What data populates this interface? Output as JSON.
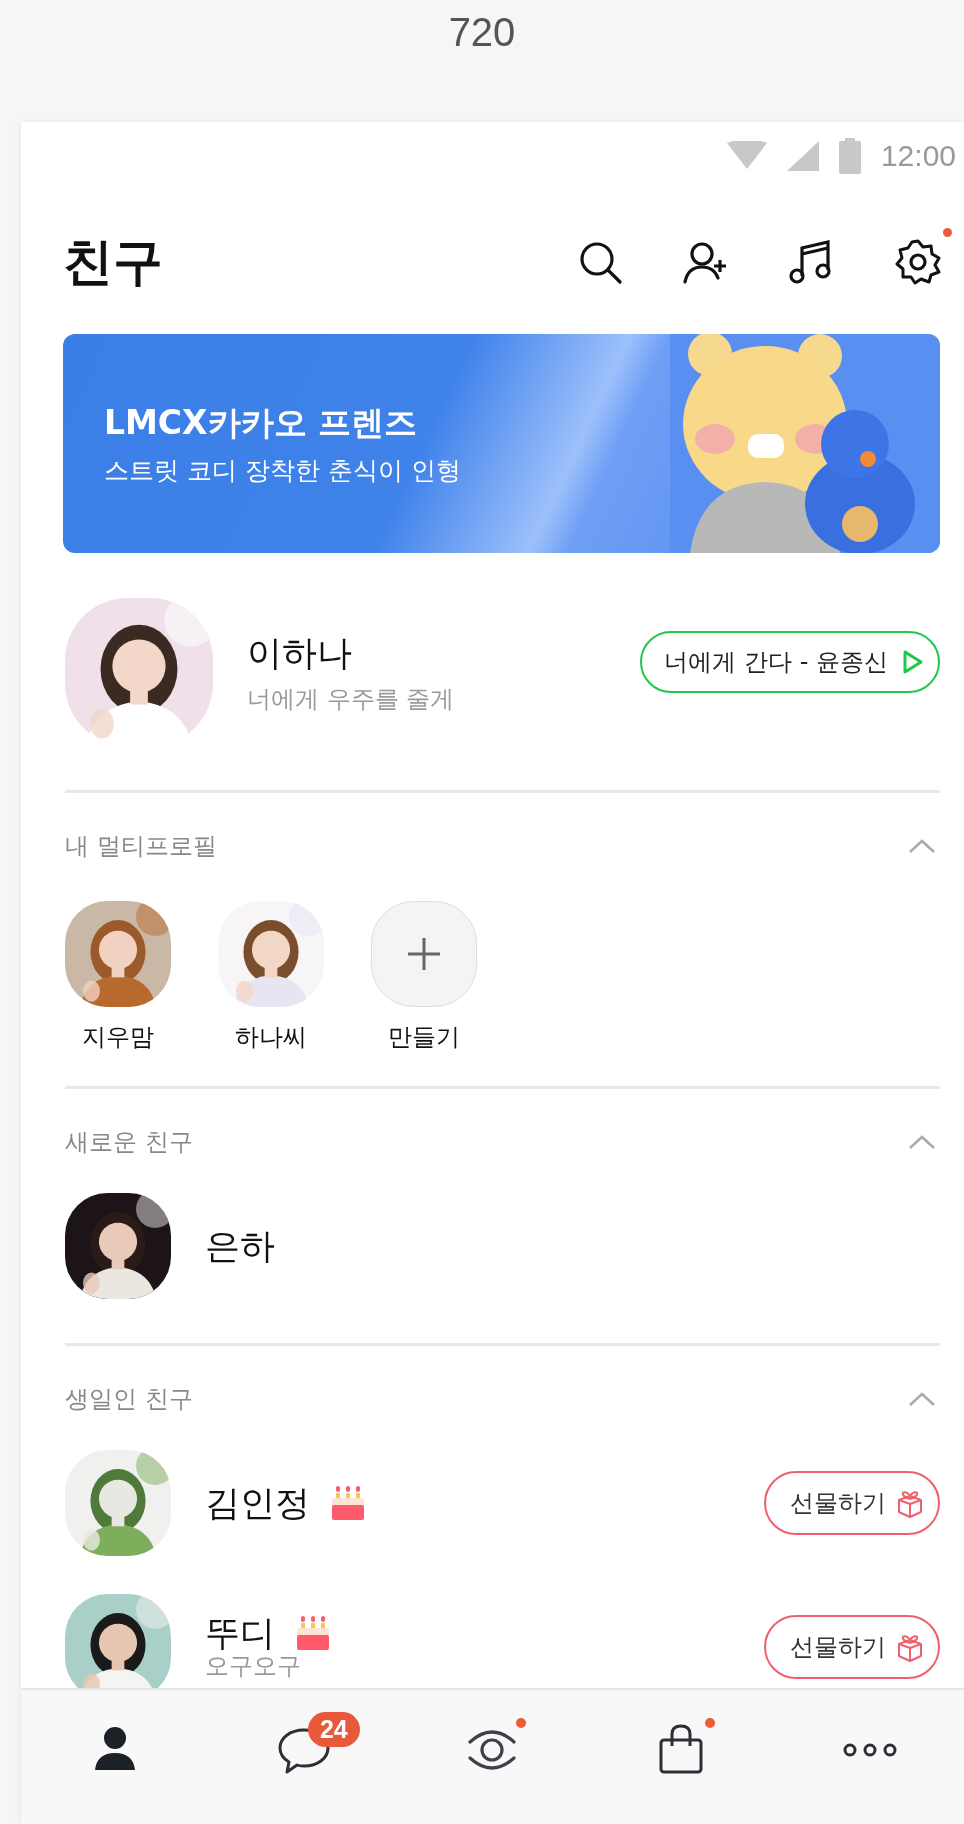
{
  "device_label": "720",
  "status_bar": {
    "time": "12:00"
  },
  "header": {
    "title": "친구",
    "actions": [
      {
        "kind": "search",
        "dot": false
      },
      {
        "kind": "add-friend",
        "dot": false
      },
      {
        "kind": "music",
        "dot": false
      },
      {
        "kind": "settings",
        "dot": true
      }
    ]
  },
  "banner": {
    "title": "LMCX카카오 프렌즈",
    "subtitle": "스트릿 코디 장착한 춘식이 인형",
    "kind": "picture"
  },
  "my_profile": {
    "name": "이하나",
    "status": "너에게 우주를 줄게",
    "music": "너에게 간다 - 윤종신"
  },
  "sections": [
    {
      "title": "내 멀티프로필",
      "expanded": true,
      "kind": "multi",
      "items": [
        {
          "name": "지우맘",
          "kind": "picture"
        },
        {
          "name": "하나씨",
          "kind": "picture"
        },
        {
          "name": "만들기",
          "kind": "add"
        }
      ]
    },
    {
      "title": "새로운 친구",
      "expanded": true,
      "kind": "friends",
      "items": [
        {
          "name": "은하"
        }
      ]
    },
    {
      "title": "생일인 친구",
      "expanded": true,
      "kind": "birthday",
      "items": [
        {
          "name": "김인정",
          "action": "선물하기"
        },
        {
          "name": "뚜디",
          "status": "오구오구",
          "action": "선물하기"
        }
      ]
    }
  ],
  "tab_bar": {
    "tabs": [
      {
        "kind": "friends",
        "selected": true
      },
      {
        "kind": "chats",
        "selected": false,
        "badge": "24"
      },
      {
        "kind": "view",
        "selected": false,
        "dot": true
      },
      {
        "kind": "shopping",
        "selected": false,
        "dot": true
      },
      {
        "kind": "more",
        "selected": false
      }
    ]
  }
}
